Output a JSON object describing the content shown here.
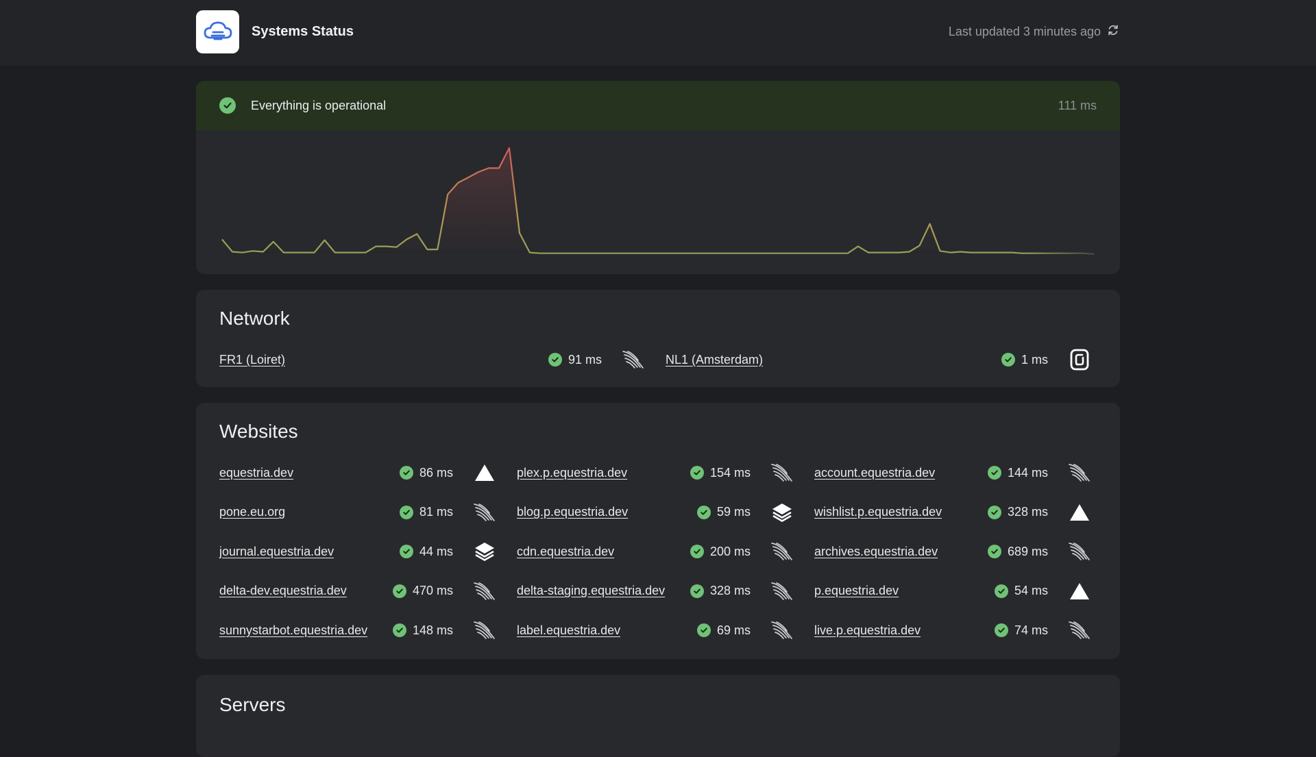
{
  "header": {
    "title": "Systems Status",
    "last_updated": "Last updated 3 minutes ago",
    "logo_icon": "cloud-icon",
    "refresh_icon": "refresh-icon"
  },
  "overall": {
    "message": "Everything is operational",
    "latency": "111 ms",
    "status_color": "#6fc276"
  },
  "chart_data": {
    "type": "area",
    "title": "",
    "xlabel": "",
    "ylabel": "",
    "grid": false,
    "legend": "none",
    "values": [
      20,
      4,
      3,
      5,
      4,
      17,
      3,
      3,
      3,
      3,
      19,
      3,
      3,
      3,
      3,
      11,
      11,
      10,
      20,
      27,
      7,
      7,
      78,
      93,
      100,
      107,
      112,
      112,
      138,
      28,
      3,
      2,
      2,
      2,
      2,
      2,
      2,
      2,
      2,
      2,
      2,
      2,
      2,
      2,
      2,
      2,
      2,
      2,
      2,
      2,
      2,
      2,
      2,
      2,
      2,
      2,
      2,
      2,
      2,
      2,
      2,
      2,
      11,
      3,
      3,
      3,
      3,
      4,
      12,
      40,
      5,
      3,
      4,
      3,
      3,
      3,
      3,
      3,
      2,
      2,
      2,
      2,
      2,
      2,
      2,
      1
    ],
    "colors": {
      "low": "#8fa35a",
      "high": "#d25c5c"
    }
  },
  "network": {
    "title": "Network",
    "items": [
      {
        "name": "FR1 (Loiret)",
        "latency": "91 ms",
        "provider_icon": "wing-icon"
      },
      {
        "name": "NL1 (Amsterdam)",
        "latency": "1 ms",
        "provider_icon": "scaleway-icon"
      }
    ]
  },
  "websites": {
    "title": "Websites",
    "items": [
      {
        "name": "equestria.dev",
        "latency": "86 ms",
        "provider_icon": "vercel-icon"
      },
      {
        "name": "plex.p.equestria.dev",
        "latency": "154 ms",
        "provider_icon": "wing-icon"
      },
      {
        "name": "account.equestria.dev",
        "latency": "144 ms",
        "provider_icon": "wing-icon"
      },
      {
        "name": "pone.eu.org",
        "latency": "81 ms",
        "provider_icon": "wing-icon"
      },
      {
        "name": "blog.p.equestria.dev",
        "latency": "59 ms",
        "provider_icon": "stack-icon"
      },
      {
        "name": "wishlist.p.equestria.dev",
        "latency": "328 ms",
        "provider_icon": "vercel-icon"
      },
      {
        "name": "journal.equestria.dev",
        "latency": "44 ms",
        "provider_icon": "stack-icon"
      },
      {
        "name": "cdn.equestria.dev",
        "latency": "200 ms",
        "provider_icon": "wing-icon"
      },
      {
        "name": "archives.equestria.dev",
        "latency": "689 ms",
        "provider_icon": "wing-icon"
      },
      {
        "name": "delta-dev.equestria.dev",
        "latency": "470 ms",
        "provider_icon": "wing-icon"
      },
      {
        "name": "delta-staging.equestria.dev",
        "latency": "328 ms",
        "provider_icon": "wing-icon"
      },
      {
        "name": "p.equestria.dev",
        "latency": "54 ms",
        "provider_icon": "vercel-icon"
      },
      {
        "name": "sunnystarbot.equestria.dev",
        "latency": "148 ms",
        "provider_icon": "wing-icon"
      },
      {
        "name": "label.equestria.dev",
        "latency": "69 ms",
        "provider_icon": "wing-icon"
      },
      {
        "name": "live.p.equestria.dev",
        "latency": "74 ms",
        "provider_icon": "wing-icon"
      }
    ]
  },
  "servers": {
    "title": "Servers"
  }
}
